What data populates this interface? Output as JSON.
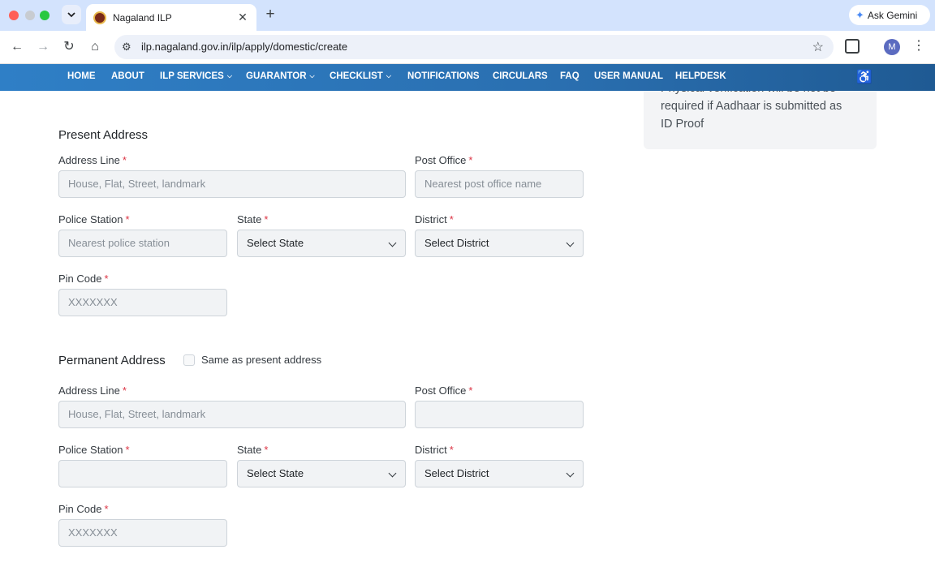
{
  "browser": {
    "tab_title": "Nagaland ILP",
    "url": "ilp.nagaland.gov.in/ilp/apply/domestic/create",
    "ask_gemini": "Ask Gemini",
    "profile_initial": "M"
  },
  "nav": {
    "items": [
      {
        "label": "HOME"
      },
      {
        "label": "ABOUT"
      },
      {
        "label": "ILP SERVICES",
        "dropdown": true
      },
      {
        "label": "GUARANTOR",
        "dropdown": true
      },
      {
        "label": "CHECKLIST",
        "dropdown": true
      },
      {
        "label": "NOTIFICATIONS"
      },
      {
        "label": "CIRCULARS"
      },
      {
        "label": "FAQ"
      },
      {
        "label": "USER MANUAL"
      },
      {
        "label": "HELPDESK"
      }
    ]
  },
  "side_note": {
    "line1": "Physical verification will be not be",
    "line2": "required if Aadhaar is submitted as",
    "line3": "ID Proof"
  },
  "present": {
    "title": "Present Address",
    "address_label": "Address Line",
    "address_placeholder": "House, Flat, Street, landmark",
    "post_office_label": "Post Office",
    "post_office_placeholder": "Nearest post office name",
    "police_label": "Police Station",
    "police_placeholder": "Nearest police station",
    "state_label": "State",
    "state_value": "Select State",
    "district_label": "District",
    "district_value": "Select District",
    "pin_label": "Pin Code",
    "pin_placeholder": "XXXXXXX"
  },
  "permanent": {
    "title": "Permanent Address",
    "same_as_label": "Same as present address",
    "address_label": "Address Line",
    "address_placeholder": "House, Flat, Street, landmark",
    "post_office_label": "Post Office",
    "post_office_placeholder": "",
    "police_label": "Police Station",
    "police_placeholder": "",
    "state_label": "State",
    "state_value": "Select State",
    "district_label": "District",
    "district_value": "Select District",
    "pin_label": "Pin Code",
    "pin_placeholder": "XXXXXXX"
  },
  "required_marker": "*"
}
